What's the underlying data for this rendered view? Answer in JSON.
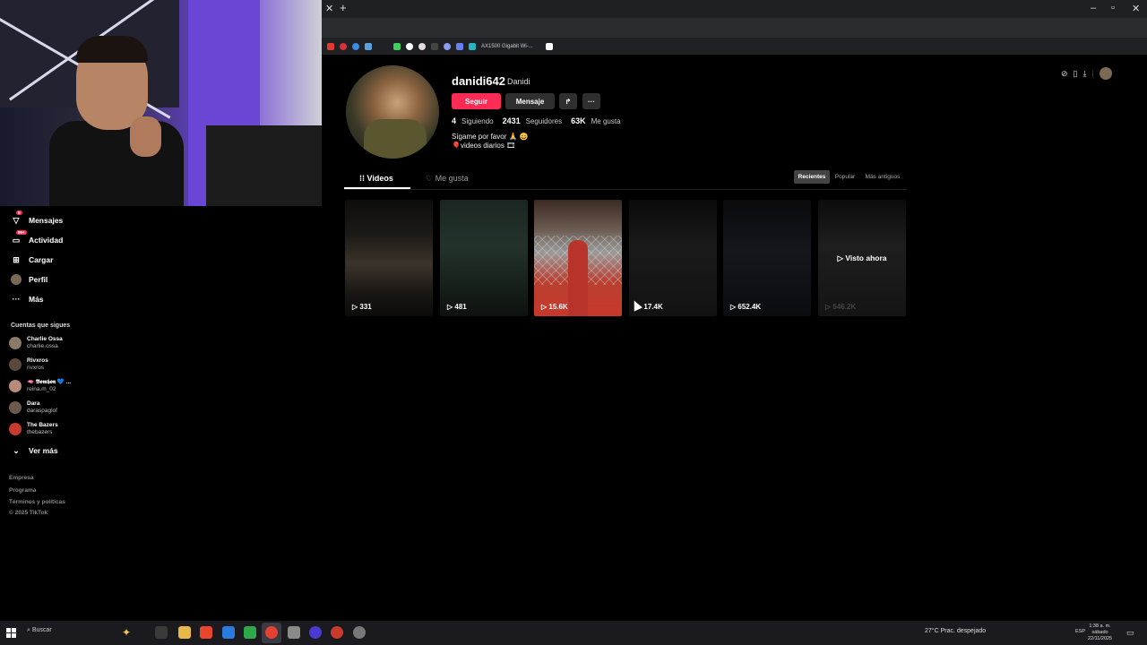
{
  "browser": {
    "bookmark_label": "AX1500 Gigabit Wi-...",
    "window_controls": [
      "–",
      "▫",
      "✕"
    ]
  },
  "profile": {
    "username": "danidi642",
    "nickname": "Danidi",
    "follow_label": "Seguir",
    "message_label": "Mensaje",
    "stats": {
      "following": "4",
      "following_label": "Siguiendo",
      "followers": "2431",
      "followers_label": "Seguidores",
      "likes": "63K",
      "likes_label": "Me gusta"
    },
    "bio_line1": "Sígame por favor 🙏 😄",
    "bio_line2": "🎈videos diarios 🎞"
  },
  "tabs": {
    "videos": "Videos",
    "likes": "Me gusta"
  },
  "sort": {
    "recent": "Recientes",
    "popular": "Popular",
    "oldest": "Más antiguos"
  },
  "videos": [
    {
      "views": "331"
    },
    {
      "views": "481"
    },
    {
      "views": "15.6K"
    },
    {
      "views": "17.4K"
    },
    {
      "views": "652.4K"
    },
    {
      "views": "546.2K",
      "overlay": "Visto ahora"
    }
  ],
  "sidebar": {
    "items": [
      {
        "label": "Mensajes",
        "badge": "9"
      },
      {
        "label": "Actividad",
        "badge": "99+"
      },
      {
        "label": "Cargar"
      },
      {
        "label": "Perfil"
      },
      {
        "label": "Más"
      }
    ],
    "following_title": "Cuentas que sigues",
    "accounts": [
      {
        "name": "Charlie Ossa",
        "handle": "charlie.ossa"
      },
      {
        "name": "Rivxros",
        "handle": "rivxros"
      },
      {
        "name": "🫦 𝕭𝖔𝖒𝖇𝖔𝖓 💙 ...",
        "handle": "reina.m_02"
      },
      {
        "name": "Dara",
        "handle": "daraspaglof"
      },
      {
        "name": "The Bazers",
        "handle": "thebazers"
      }
    ],
    "see_more": "Ver más",
    "footer": [
      "Empresa",
      "Programa",
      "Términos y políticas",
      "© 2025 TikTok"
    ]
  },
  "taskbar": {
    "search": "Buscar",
    "weather": "27°C  Prac. despejado",
    "lang": "ESP",
    "time": "1:38 a. m.",
    "day": "sábado",
    "date": "22/11/2025"
  }
}
